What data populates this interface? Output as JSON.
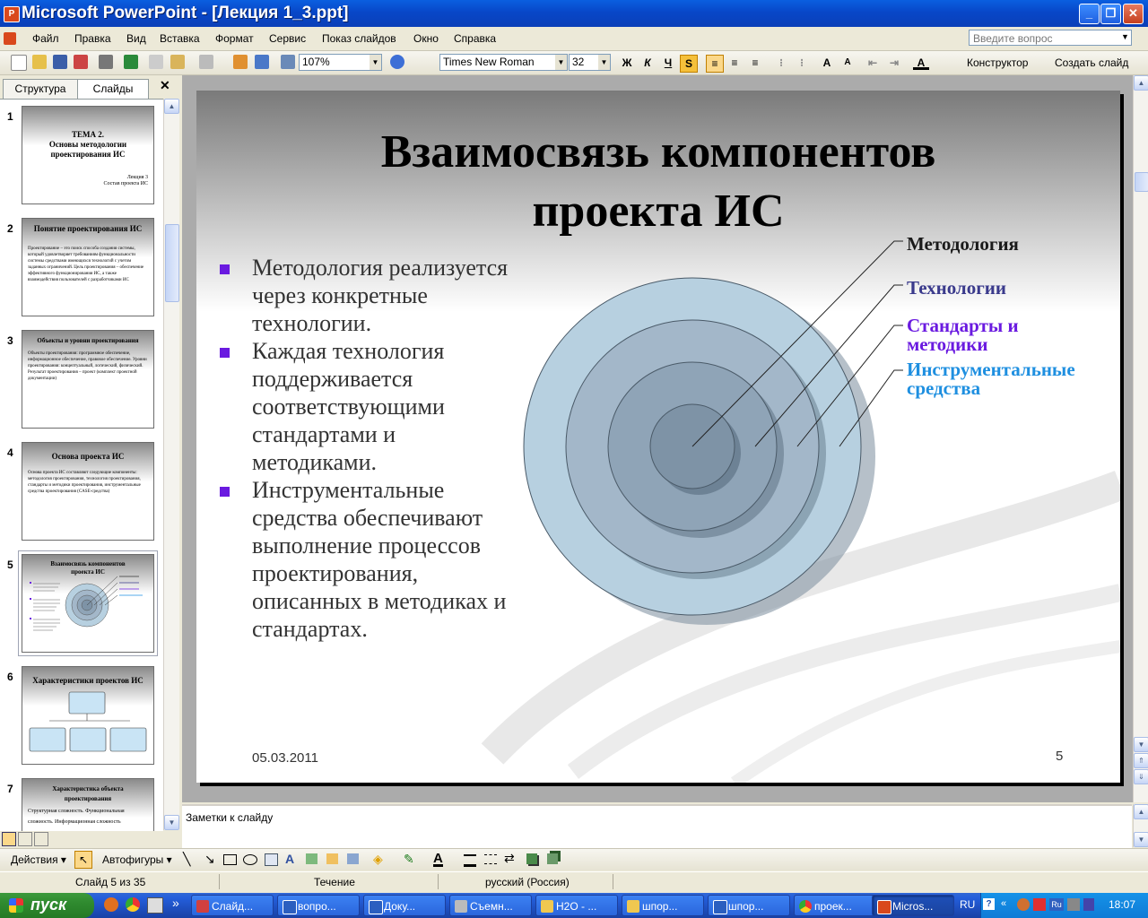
{
  "window": {
    "title": "Microsoft PowerPoint - [Лекция 1_3.ppt]",
    "minimize": "_",
    "restore": "❐",
    "close": "✕"
  },
  "menu": {
    "items": [
      "Файл",
      "Правка",
      "Вид",
      "Вставка",
      "Формат",
      "Сервис",
      "Показ слайдов",
      "Окно",
      "Справка"
    ],
    "ask_placeholder": "Введите вопрос"
  },
  "toolbar": {
    "zoom": "107%",
    "font": "Times New Roman",
    "size": "32",
    "bold": "Ж",
    "italic": "К",
    "underline": "Ч",
    "shadow": "S",
    "designer": "Конструктор",
    "new_slide": "Создать слайд"
  },
  "panes": {
    "tab_outline": "Структура",
    "tab_slides": "Слайды",
    "close": "✕"
  },
  "thumbnails": [
    {
      "num": "1",
      "title": "ТЕМА 2.\nОсновы методологии проектирования ИС",
      "body": "Лекция 3\nСостав проекта ИС"
    },
    {
      "num": "2",
      "title": "Понятие проектирования ИС",
      "body": "Проектирование – это поиск способа создания системы, который удовлетворяет требованиям функциональности системы средствами имеющихся технологий с учетом заданных ограничений. Цель проектирования – обеспечение эффективного функционирования ИС, а также взаимодействия пользователей с разработчиками ИС"
    },
    {
      "num": "3",
      "title": "Объекты и уровни проектирования",
      "body": "Объекты проектирования: программное обеспечение, информационное обеспечение, правовое обеспечение. Уровни проектирования: концептуальный, логический, физический. Результат проектирования – проект (комплект проектной документации)"
    },
    {
      "num": "4",
      "title": "Основа проекта ИС",
      "body": "Основа проекта ИС составляют следующие компоненты: методология проектирования, технология проектирования, стандарты и методики проектирования, инструментальные средства проектирования (CASE-средства)"
    },
    {
      "num": "5",
      "title": "Взаимосвязь компонентов проекта ИС",
      "body": ""
    },
    {
      "num": "6",
      "title": "Характеристики проектов ИС",
      "body": ""
    },
    {
      "num": "7",
      "title": "Характеристика объекта проектирования",
      "body": "Структурная сложность. Функциональная сложность. Информационная сложность"
    }
  ],
  "slide": {
    "title": "Взаимосвязь компонентов проекта ИС",
    "bullets": [
      "Методология реализуется через конкретные технологии.",
      "Каждая технология поддерживается соответствующими стандартами и методиками.",
      "Инструментальные средства обеспечивают выполнение процессов проектирования, описанных в методиках и стандартах."
    ],
    "labels": [
      {
        "text": "Методология",
        "color": "#1a1a1a"
      },
      {
        "text": "Технологии",
        "color": "#3a3a8c"
      },
      {
        "text": "Стандарты и\nметодики",
        "color": "#6a1ae0"
      },
      {
        "text": "Инструментальные\nсредства",
        "color": "#1e8fe0"
      }
    ],
    "date": "05.03.2011",
    "number": "5"
  },
  "notes": {
    "placeholder": "Заметки к слайду"
  },
  "drawbar": {
    "actions": "Действия",
    "autoshapes": "Автофигуры"
  },
  "status": {
    "slide": "Слайд 5 из 35",
    "design": "Течение",
    "language": "русский (Россия)"
  },
  "taskbar": {
    "start": "пуск",
    "tasks": [
      "Слайд...",
      "вопро...",
      "Доку...",
      "Съемн...",
      "H2O - ...",
      "шпор...",
      "шпор...",
      "проек...",
      "Micros..."
    ],
    "lang": "RU",
    "time": "18:07"
  },
  "colors": {
    "bullet": "#6a1ae0",
    "ring_outer": "#b7d0e0",
    "ring_2": "#a3b7c9",
    "ring_3": "#8fa4b7",
    "ring_core": "#7e93a6"
  }
}
